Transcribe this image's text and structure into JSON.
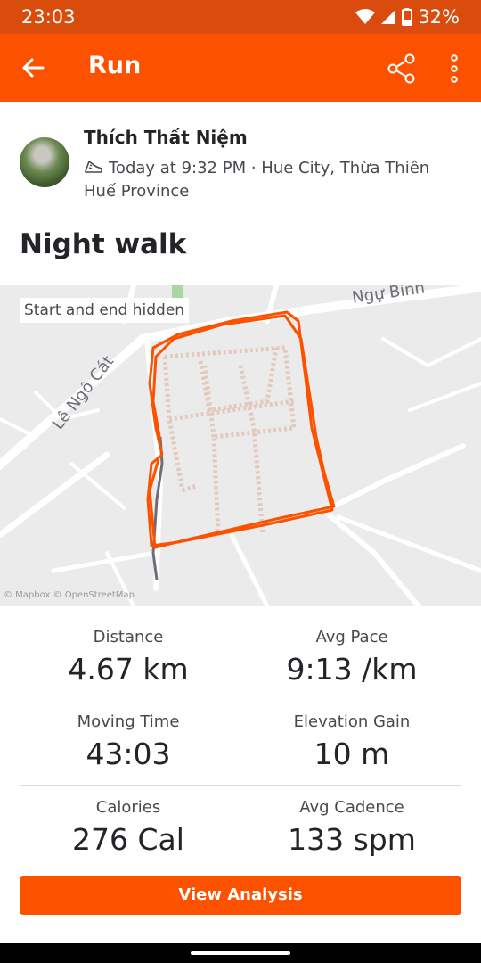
{
  "status_bar": {
    "time": "23:03",
    "battery": "32%"
  },
  "app_bar": {
    "title": "Run"
  },
  "activity": {
    "athlete_name": "Thích Thất Niệm",
    "datetime_location": "Today at 9:32 PM · Hue City, Thừa Thiên Huế Province",
    "title": "Night walk"
  },
  "map": {
    "privacy_label": "Start and end hidden",
    "road_labels": {
      "le_ngo_cat": "Lê Ngô Cát",
      "ngu_binh": "Ngự Bình"
    },
    "attribution": "© Mapbox © OpenStreetMap",
    "route_color": "#fc5200"
  },
  "stats": [
    {
      "label": "Distance",
      "value": "4.67 km"
    },
    {
      "label": "Avg Pace",
      "value": "9:13 /km"
    },
    {
      "label": "Moving Time",
      "value": "43:03"
    },
    {
      "label": "Elevation Gain",
      "value": "10 m"
    },
    {
      "label": "Calories",
      "value": "276 Cal"
    },
    {
      "label": "Avg Cadence",
      "value": "133 spm"
    }
  ],
  "actions": {
    "view_analysis": "View Analysis"
  },
  "icons": {
    "back": "arrow-left-icon",
    "share": "share-icon",
    "more": "more-vert-icon",
    "shoe": "shoe-icon",
    "wifi": "wifi-icon",
    "signal": "signal-icon",
    "battery": "battery-icon"
  },
  "colors": {
    "brand": "#fc5200",
    "status_bar": "#d94c0d"
  }
}
